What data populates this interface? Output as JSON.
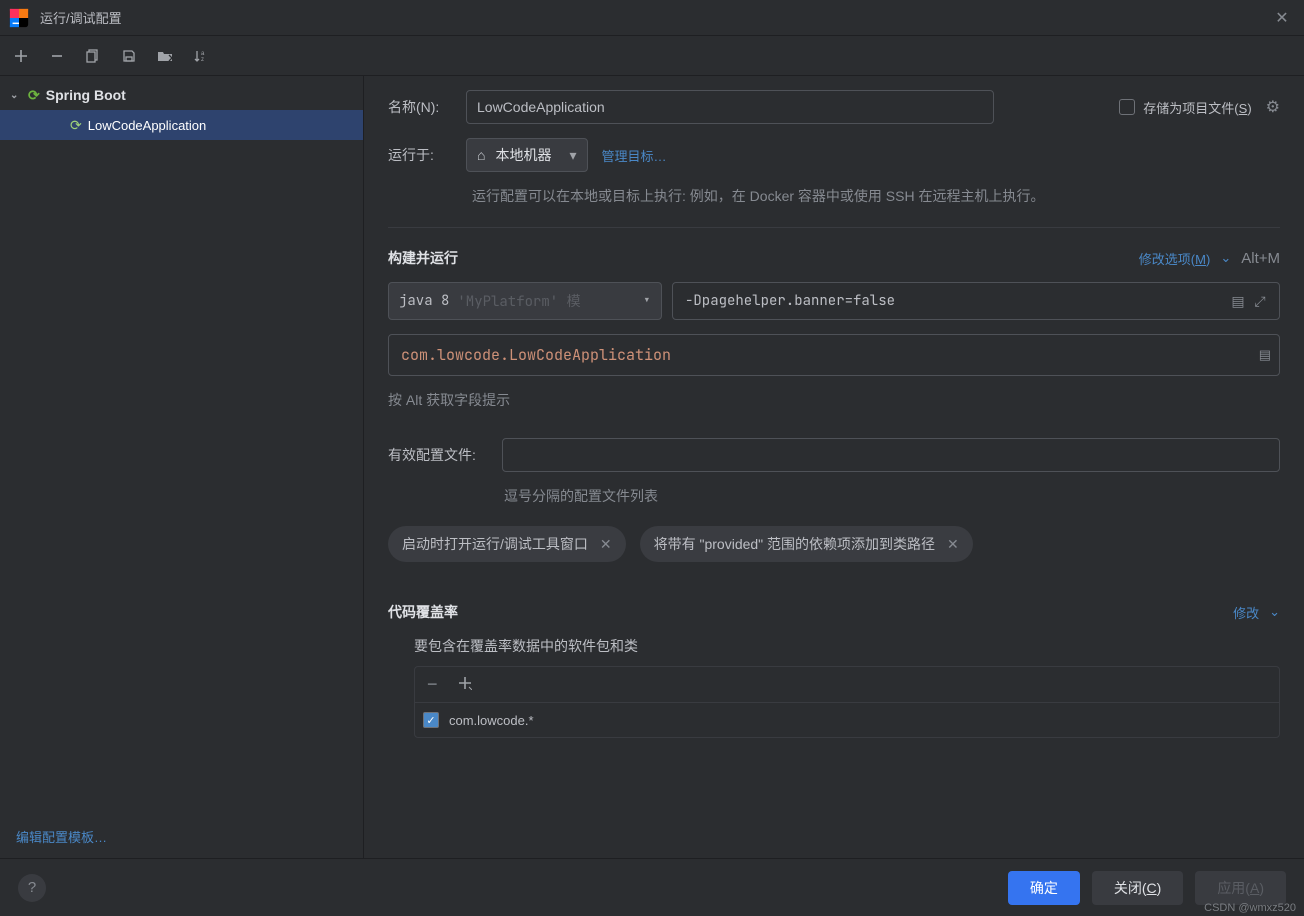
{
  "window": {
    "title": "运行/调试配置"
  },
  "tree": {
    "group": "Spring Boot",
    "item": "LowCodeApplication"
  },
  "sidebar_footer": "编辑配置模板…",
  "form": {
    "name_label": "名称(N):",
    "name_value": "LowCodeApplication",
    "store_label_pre": "存储为项目文件(",
    "store_label_u": "S",
    "store_label_post": ")",
    "run_on_label": "运行于:",
    "run_on_value": "本地机器",
    "manage_targets": "管理目标…",
    "run_desc": "运行配置可以在本地或目标上执行: 例如，在 Docker 容器中或使用 SSH 在远程主机上执行。"
  },
  "build": {
    "title": "构建并运行",
    "modify_pre": "修改选项(",
    "modify_u": "M",
    "modify_post": ")",
    "shortcut": "Alt+M",
    "jdk": "java 8",
    "jdk_placeholder": "'MyPlatform'  模",
    "vm_opts": "-Dpagehelper.banner=false",
    "main_class": "com.lowcode.LowCodeApplication",
    "alt_hint": "按 Alt 获取字段提示",
    "profiles_label": "有效配置文件:",
    "profiles_hint": "逗号分隔的配置文件列表",
    "pill1": "启动时打开运行/调试工具窗口",
    "pill2": "将带有 \"provided\" 范围的依赖项添加到类路径"
  },
  "coverage": {
    "title": "代码覆盖率",
    "modify": "修改",
    "subtitle": "要包含在覆盖率数据中的软件包和类",
    "package": "com.lowcode.*"
  },
  "footer": {
    "ok": "确定",
    "close_pre": "关闭(",
    "close_u": "C",
    "close_post": ")",
    "apply_pre": "应用(",
    "apply_u": "A",
    "apply_post": ")"
  },
  "watermark": "CSDN @wmxz520"
}
